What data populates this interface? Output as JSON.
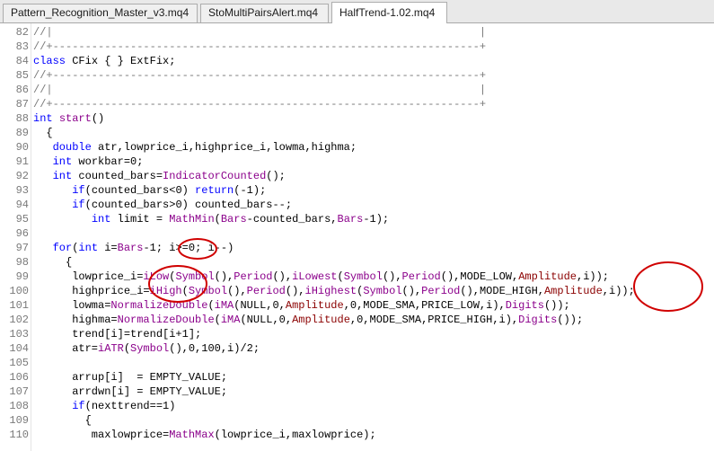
{
  "tabs": [
    {
      "label": "Pattern_Recognition_Master_v3.mq4",
      "active": false
    },
    {
      "label": "StoMultiPairsAlert.mq4",
      "active": false
    },
    {
      "label": "HalfTrend-1.02.mq4",
      "active": true
    }
  ],
  "colors": {
    "keyword": "#0000ff",
    "function": "#8b008b",
    "macro": "#8b0000",
    "comment": "#7a7a7a",
    "annotation": "#d00000"
  },
  "lines": [
    {
      "n": "82",
      "segs": [
        [
          "cm",
          "//|                                                                  |"
        ]
      ]
    },
    {
      "n": "83",
      "segs": [
        [
          "cm",
          "//+------------------------------------------------------------------+"
        ]
      ]
    },
    {
      "n": "84",
      "segs": [
        [
          "kw",
          "class"
        ],
        [
          "tx",
          " CFix { } ExtFix;"
        ]
      ]
    },
    {
      "n": "85",
      "segs": [
        [
          "cm",
          "//+------------------------------------------------------------------+"
        ]
      ]
    },
    {
      "n": "86",
      "segs": [
        [
          "cm",
          "//|                                                                  |"
        ]
      ]
    },
    {
      "n": "87",
      "segs": [
        [
          "cm",
          "//+------------------------------------------------------------------+"
        ]
      ]
    },
    {
      "n": "88",
      "segs": [
        [
          "kw",
          "int"
        ],
        [
          "tx",
          " "
        ],
        [
          "fn",
          "start"
        ],
        [
          "tx",
          "()"
        ]
      ]
    },
    {
      "n": "89",
      "segs": [
        [
          "tx",
          "  {"
        ]
      ]
    },
    {
      "n": "90",
      "segs": [
        [
          "tx",
          "   "
        ],
        [
          "kw",
          "double"
        ],
        [
          "tx",
          " atr,lowprice_i,highprice_i,lowma,highma;"
        ]
      ]
    },
    {
      "n": "91",
      "segs": [
        [
          "tx",
          "   "
        ],
        [
          "kw",
          "int"
        ],
        [
          "tx",
          " workbar=0;"
        ]
      ]
    },
    {
      "n": "92",
      "segs": [
        [
          "tx",
          "   "
        ],
        [
          "kw",
          "int"
        ],
        [
          "tx",
          " counted_bars="
        ],
        [
          "fn",
          "IndicatorCounted"
        ],
        [
          "tx",
          "();"
        ]
      ]
    },
    {
      "n": "93",
      "segs": [
        [
          "tx",
          "      "
        ],
        [
          "kw",
          "if"
        ],
        [
          "tx",
          "(counted_bars<0) "
        ],
        [
          "kw",
          "return"
        ],
        [
          "tx",
          "(-1);"
        ]
      ]
    },
    {
      "n": "94",
      "segs": [
        [
          "tx",
          "      "
        ],
        [
          "kw",
          "if"
        ],
        [
          "tx",
          "(counted_bars>0) counted_bars--;"
        ]
      ]
    },
    {
      "n": "95",
      "segs": [
        [
          "tx",
          "         "
        ],
        [
          "kw",
          "int"
        ],
        [
          "tx",
          " limit = "
        ],
        [
          "fn",
          "MathMin"
        ],
        [
          "tx",
          "("
        ],
        [
          "fn",
          "Bars"
        ],
        [
          "tx",
          "-counted_bars,"
        ],
        [
          "fn",
          "Bars"
        ],
        [
          "tx",
          "-1);"
        ]
      ]
    },
    {
      "n": "96",
      "segs": []
    },
    {
      "n": "97",
      "segs": [
        [
          "tx",
          "   "
        ],
        [
          "kw",
          "for"
        ],
        [
          "tx",
          "("
        ],
        [
          "kw",
          "int"
        ],
        [
          "tx",
          " i="
        ],
        [
          "fn",
          "Bars"
        ],
        [
          "tx",
          "-1; i>=0; i--)"
        ]
      ]
    },
    {
      "n": "98",
      "segs": [
        [
          "tx",
          "     {"
        ]
      ]
    },
    {
      "n": "99",
      "segs": [
        [
          "tx",
          "      lowprice_i="
        ],
        [
          "fn",
          "iLow"
        ],
        [
          "tx",
          "("
        ],
        [
          "fn",
          "Symbol"
        ],
        [
          "tx",
          "(),"
        ],
        [
          "fn",
          "Period"
        ],
        [
          "tx",
          "(),"
        ],
        [
          "fn",
          "iLowest"
        ],
        [
          "tx",
          "("
        ],
        [
          "fn",
          "Symbol"
        ],
        [
          "tx",
          "(),"
        ],
        [
          "fn",
          "Period"
        ],
        [
          "tx",
          "(),MODE_LOW,"
        ],
        [
          "mac",
          "Amplitude"
        ],
        [
          "tx",
          ",i));"
        ]
      ]
    },
    {
      "n": "100",
      "segs": [
        [
          "tx",
          "      highprice_i="
        ],
        [
          "fn",
          "iHigh"
        ],
        [
          "tx",
          "("
        ],
        [
          "fn",
          "Symbol"
        ],
        [
          "tx",
          "(),"
        ],
        [
          "fn",
          "Period"
        ],
        [
          "tx",
          "(),"
        ],
        [
          "fn",
          "iHighest"
        ],
        [
          "tx",
          "("
        ],
        [
          "fn",
          "Symbol"
        ],
        [
          "tx",
          "(),"
        ],
        [
          "fn",
          "Period"
        ],
        [
          "tx",
          "(),MODE_HIGH,"
        ],
        [
          "mac",
          "Amplitude"
        ],
        [
          "tx",
          ",i));"
        ]
      ]
    },
    {
      "n": "101",
      "segs": [
        [
          "tx",
          "      lowma="
        ],
        [
          "fn",
          "NormalizeDouble"
        ],
        [
          "tx",
          "("
        ],
        [
          "fn",
          "iMA"
        ],
        [
          "tx",
          "(NULL,0,"
        ],
        [
          "mac",
          "Amplitude"
        ],
        [
          "tx",
          ",0,MODE_SMA,PRICE_LOW,i),"
        ],
        [
          "fn",
          "Digits"
        ],
        [
          "tx",
          "());"
        ]
      ]
    },
    {
      "n": "102",
      "segs": [
        [
          "tx",
          "      highma="
        ],
        [
          "fn",
          "NormalizeDouble"
        ],
        [
          "tx",
          "("
        ],
        [
          "fn",
          "iMA"
        ],
        [
          "tx",
          "(NULL,0,"
        ],
        [
          "mac",
          "Amplitude"
        ],
        [
          "tx",
          ",0,MODE_SMA,PRICE_HIGH,i),"
        ],
        [
          "fn",
          "Digits"
        ],
        [
          "tx",
          "());"
        ]
      ]
    },
    {
      "n": "103",
      "segs": [
        [
          "tx",
          "      trend[i]=trend[i+1];"
        ]
      ]
    },
    {
      "n": "104",
      "segs": [
        [
          "tx",
          "      atr="
        ],
        [
          "fn",
          "iATR"
        ],
        [
          "tx",
          "("
        ],
        [
          "fn",
          "Symbol"
        ],
        [
          "tx",
          "(),0,100,i)/2;"
        ]
      ]
    },
    {
      "n": "105",
      "segs": []
    },
    {
      "n": "106",
      "segs": [
        [
          "tx",
          "      arrup[i]  = EMPTY_VALUE;"
        ]
      ]
    },
    {
      "n": "107",
      "segs": [
        [
          "tx",
          "      arrdwn[i] = EMPTY_VALUE;"
        ]
      ]
    },
    {
      "n": "108",
      "segs": [
        [
          "tx",
          "      "
        ],
        [
          "kw",
          "if"
        ],
        [
          "tx",
          "(nexttrend==1)"
        ]
      ]
    },
    {
      "n": "109",
      "segs": [
        [
          "tx",
          "        {"
        ]
      ]
    },
    {
      "n": "110",
      "segs": [
        [
          "tx",
          "         maxlowprice="
        ],
        [
          "fn",
          "MathMax"
        ],
        [
          "tx",
          "(lowprice_i,maxlowprice);"
        ]
      ]
    }
  ]
}
